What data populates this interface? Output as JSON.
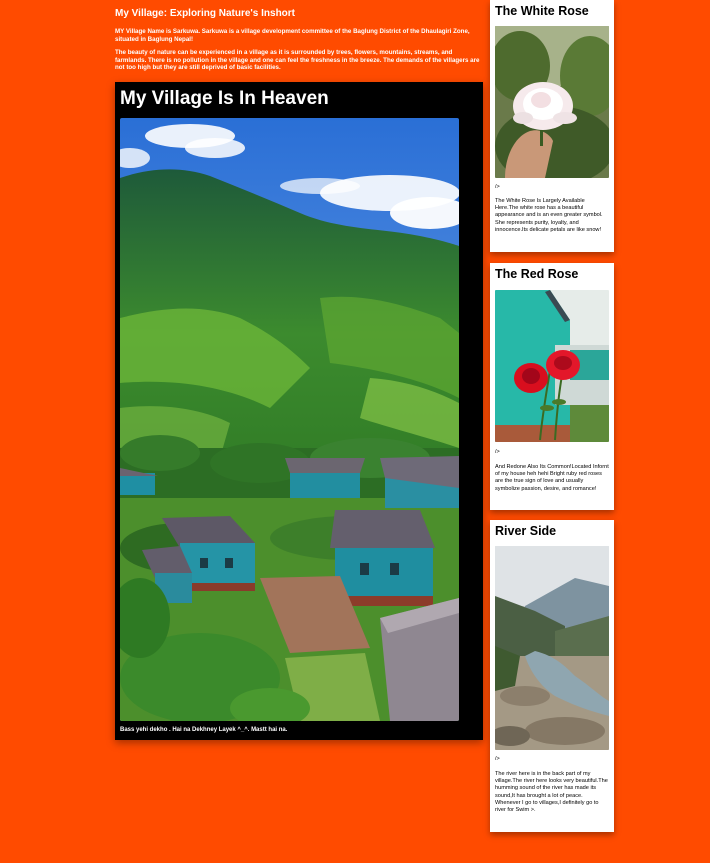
{
  "intro": {
    "title": "My Village: Exploring Nature's Inshort",
    "paragraph1": "MY Village Name is Sarkuwa. Sarkuwa is a village development committee of the Baglung District of the Dhaulagiri Zone, situated in Baglung Nepal!",
    "paragraph2": "The beauty of nature can be experienced in a village as it is surrounded by trees, flowers, mountains, streams, and farmlands. There is no pollution in the village and one can feel the freshness in the breeze. The demands of the villagers are not too high but they are still deprived of basic facilities."
  },
  "heaven": {
    "title": "My Village Is In Heaven",
    "caption": "Bass yehi dekho . Hai na Dekhney Layek ^_^. Mastt hai na."
  },
  "cards": [
    {
      "title": "The White Rose",
      "marker": "/>",
      "text": "The White Rose Is Largely Available Here.The white rose has a beautiful appearance and is an even greater symbol. She represents purity, loyalty, and innocence.Its delicate petals are like snow!"
    },
    {
      "title": "The Red Rose",
      "marker": "/>",
      "text": "And Redone Also Its Common!Located Infornt of my house heh hehi Bright ruby red roses are the true sign of love and usually symbolize passion, desire, and romance!"
    },
    {
      "title": "River Side",
      "marker": "/>",
      "text": "The river here is in the back part of my village.The river here looks very beautiful.The humming sound of the river has made its sound,It has brought a lot of peace. Whenever I go to villages,I definitely go to river for Swim >."
    }
  ],
  "colors": {
    "background": "#ff4b00",
    "heaven_card": "#000000",
    "side_card": "#ffffff"
  }
}
